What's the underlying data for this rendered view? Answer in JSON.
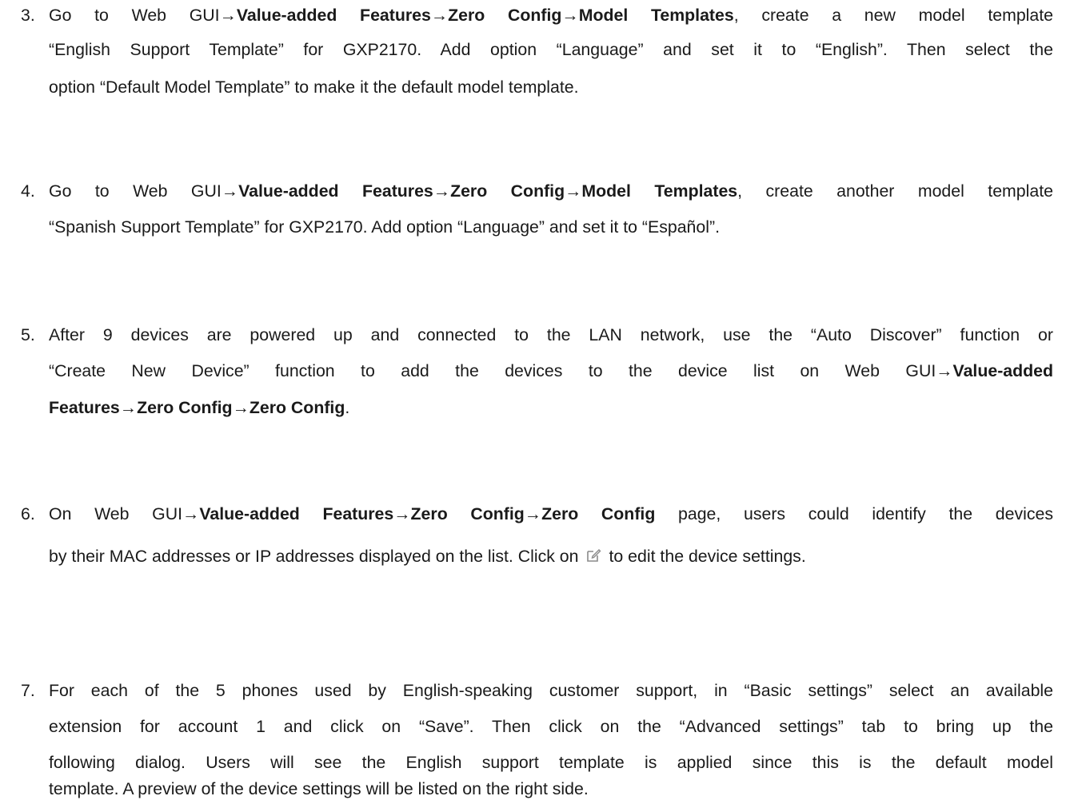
{
  "doc": {
    "items": [
      {
        "number": "3.",
        "segments": {
          "s1": "Go to Web GUI",
          "arrow": "→",
          "b1": "Value-added Features",
          "b2": "Zero Config",
          "b3": "Model Templates",
          "s2": ", create a new model template",
          "l2": "“English Support Template” for GXP2170. Add option “Language” and set it to “English”. Then select the",
          "l3": "option “Default Model Template” to make it the default model template."
        }
      },
      {
        "number": "4.",
        "segments": {
          "s1": "Go to Web GUI",
          "arrow": "→",
          "b1": "Value-added Features",
          "b2": "Zero Config",
          "b3": "Model Templates",
          "s2": ", create another model template",
          "l2": "“Spanish Support Template” for GXP2170. Add option “Language” and set it to “Español”."
        }
      },
      {
        "number": "5.",
        "segments": {
          "l1": "After 9 devices are powered up and connected to the LAN network, use the “Auto Discover” function or",
          "l2a": "“Create New Device” function to add the devices to the device list on Web GUI",
          "arrow": "→",
          "b1": "Value-added",
          "b2": "Features",
          "b3": "Zero Config",
          "b4": "Zero Config",
          "end": "."
        }
      },
      {
        "number": "6.",
        "segments": {
          "s1": "On Web GUI",
          "arrow": "→",
          "b1": "Value-added Features",
          "b2": "Zero Config",
          "b3": "Zero Config",
          "s2": " page, users could identify the devices",
          "l2a": "by their MAC addresses or IP addresses displayed on the list. Click on",
          "l2b": "to edit the device settings.",
          "icon": "edit-icon"
        }
      },
      {
        "number": "7.",
        "segments": {
          "l1": "For each of the 5 phones used by English-speaking customer support, in “Basic settings” select an available",
          "l2": "extension for account 1 and click on “Save”. Then click on the “Advanced settings” tab to bring up the",
          "l3": "following dialog. Users will see the English support template is applied since this is the default model",
          "l4": "template. A preview of the device settings will be listed on the right side."
        }
      }
    ]
  }
}
